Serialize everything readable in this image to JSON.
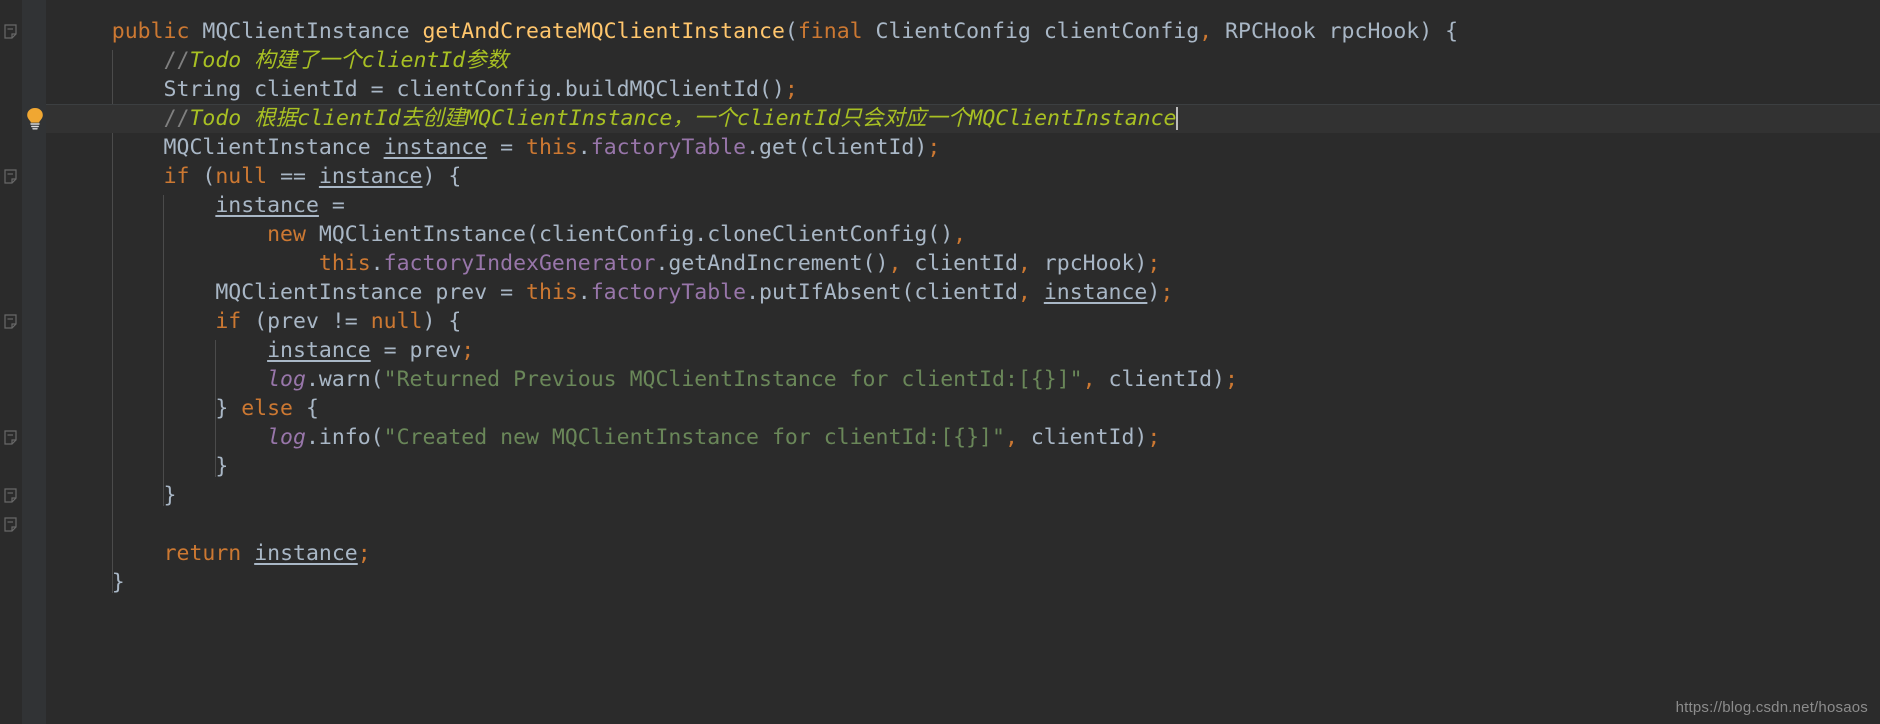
{
  "editor": {
    "theme_name": "darcula",
    "background": "#2b2b2b",
    "gutter_background": "#313335",
    "caret_line_background": "#323232",
    "default_text_color": "#a9b7c6"
  },
  "gutter": {
    "bulb_icon": "lightbulb-intention-icon",
    "bulb_color": "#f0a732",
    "fold_icon": "code-fold-region-icon",
    "fold_rows": [
      1,
      6,
      11,
      15,
      17,
      18,
      22
    ]
  },
  "code": {
    "lines": [
      {
        "n": 1,
        "fold": true,
        "tokens": [
          {
            "t": "    ",
            "c": "plain"
          },
          {
            "t": "public",
            "c": "kw"
          },
          {
            "t": " ",
            "c": "plain"
          },
          {
            "t": "MQClientInstance",
            "c": "cls"
          },
          {
            "t": " ",
            "c": "plain"
          },
          {
            "t": "getAndCreateMQClientInstance",
            "c": "mdecl"
          },
          {
            "t": "(",
            "c": "plain"
          },
          {
            "t": "final",
            "c": "kw"
          },
          {
            "t": " ",
            "c": "plain"
          },
          {
            "t": "ClientConfig clientConfig",
            "c": "plain"
          },
          {
            "t": ",",
            "c": "semi"
          },
          {
            "t": " RPCHook rpcHook) {",
            "c": "plain"
          }
        ]
      },
      {
        "n": 2,
        "tokens": [
          {
            "t": "        ",
            "c": "plain"
          },
          {
            "t": "//",
            "c": "cmt"
          },
          {
            "t": "Todo 构建了一个clientId参数",
            "c": "todo"
          }
        ]
      },
      {
        "n": 3,
        "tokens": [
          {
            "t": "        String clientId = clientConfig.buildMQClientId()",
            "c": "plain"
          },
          {
            "t": ";",
            "c": "semi"
          }
        ]
      },
      {
        "n": 4,
        "caret_line": true,
        "bulb": true,
        "tokens": [
          {
            "t": "        ",
            "c": "plain"
          },
          {
            "t": "//",
            "c": "cmt"
          },
          {
            "t": "Todo 根据clientId去创建MQClientInstance，一个clientId只会对应一个MQClientInstance",
            "c": "todo"
          },
          {
            "t": "",
            "c": "caret"
          }
        ]
      },
      {
        "n": 5,
        "tokens": [
          {
            "t": "        MQClientInstance ",
            "c": "plain"
          },
          {
            "t": "instance",
            "c": "local"
          },
          {
            "t": " = ",
            "c": "plain"
          },
          {
            "t": "this",
            "c": "kw"
          },
          {
            "t": ".",
            "c": "plain"
          },
          {
            "t": "factoryTable",
            "c": "field"
          },
          {
            "t": ".get(clientId)",
            "c": "plain"
          },
          {
            "t": ";",
            "c": "semi"
          }
        ]
      },
      {
        "n": 6,
        "fold": true,
        "tokens": [
          {
            "t": "        ",
            "c": "plain"
          },
          {
            "t": "if",
            "c": "kw"
          },
          {
            "t": " (",
            "c": "plain"
          },
          {
            "t": "null",
            "c": "kw"
          },
          {
            "t": " == ",
            "c": "plain"
          },
          {
            "t": "instance",
            "c": "local"
          },
          {
            "t": ") {",
            "c": "plain"
          }
        ]
      },
      {
        "n": 7,
        "tokens": [
          {
            "t": "            ",
            "c": "plain"
          },
          {
            "t": "instance",
            "c": "local"
          },
          {
            "t": " =",
            "c": "plain"
          }
        ]
      },
      {
        "n": 8,
        "tokens": [
          {
            "t": "                ",
            "c": "plain"
          },
          {
            "t": "new",
            "c": "kw"
          },
          {
            "t": " MQClientInstance(clientConfig.cloneClientConfig()",
            "c": "plain"
          },
          {
            "t": ",",
            "c": "semi"
          }
        ]
      },
      {
        "n": 9,
        "tokens": [
          {
            "t": "                    ",
            "c": "plain"
          },
          {
            "t": "this",
            "c": "kw"
          },
          {
            "t": ".",
            "c": "plain"
          },
          {
            "t": "factoryIndexGenerator",
            "c": "field"
          },
          {
            "t": ".getAndIncrement()",
            "c": "plain"
          },
          {
            "t": ",",
            "c": "semi"
          },
          {
            "t": " clientId",
            "c": "plain"
          },
          {
            "t": ",",
            "c": "semi"
          },
          {
            "t": " rpcHook)",
            "c": "plain"
          },
          {
            "t": ";",
            "c": "semi"
          }
        ]
      },
      {
        "n": 10,
        "tokens": [
          {
            "t": "            MQClientInstance prev = ",
            "c": "plain"
          },
          {
            "t": "this",
            "c": "kw"
          },
          {
            "t": ".",
            "c": "plain"
          },
          {
            "t": "factoryTable",
            "c": "field"
          },
          {
            "t": ".putIfAbsent(clientId",
            "c": "plain"
          },
          {
            "t": ",",
            "c": "semi"
          },
          {
            "t": " ",
            "c": "plain"
          },
          {
            "t": "instance",
            "c": "local"
          },
          {
            "t": ")",
            "c": "plain"
          },
          {
            "t": ";",
            "c": "semi"
          }
        ]
      },
      {
        "n": 11,
        "fold": true,
        "tokens": [
          {
            "t": "            ",
            "c": "plain"
          },
          {
            "t": "if",
            "c": "kw"
          },
          {
            "t": " (prev != ",
            "c": "plain"
          },
          {
            "t": "null",
            "c": "kw"
          },
          {
            "t": ") {",
            "c": "plain"
          }
        ]
      },
      {
        "n": 12,
        "tokens": [
          {
            "t": "                ",
            "c": "plain"
          },
          {
            "t": "instance",
            "c": "local"
          },
          {
            "t": " = prev",
            "c": "plain"
          },
          {
            "t": ";",
            "c": "semi"
          }
        ]
      },
      {
        "n": 13,
        "tokens": [
          {
            "t": "                ",
            "c": "plain"
          },
          {
            "t": "log",
            "c": "logv"
          },
          {
            "t": ".warn(",
            "c": "plain"
          },
          {
            "t": "\"Returned Previous MQClientInstance for clientId:[{}]\"",
            "c": "str"
          },
          {
            "t": ",",
            "c": "semi"
          },
          {
            "t": " clientId)",
            "c": "plain"
          },
          {
            "t": ";",
            "c": "semi"
          }
        ]
      },
      {
        "n": 14,
        "tokens": [
          {
            "t": "            } ",
            "c": "plain"
          },
          {
            "t": "else",
            "c": "kw"
          },
          {
            "t": " {",
            "c": "plain"
          }
        ]
      },
      {
        "n": 15,
        "fold": true,
        "tokens": [
          {
            "t": "                ",
            "c": "plain"
          },
          {
            "t": "log",
            "c": "logv"
          },
          {
            "t": ".info(",
            "c": "plain"
          },
          {
            "t": "\"Created new MQClientInstance for clientId:[{}]\"",
            "c": "str"
          },
          {
            "t": ",",
            "c": "semi"
          },
          {
            "t": " clientId)",
            "c": "plain"
          },
          {
            "t": ";",
            "c": "semi"
          }
        ]
      },
      {
        "n": 16,
        "tokens": [
          {
            "t": "            }",
            "c": "plain"
          }
        ]
      },
      {
        "n": 17,
        "fold": true,
        "tokens": [
          {
            "t": "        }",
            "c": "plain"
          }
        ]
      },
      {
        "n": 18,
        "fold": true,
        "tokens": [
          {
            "t": "",
            "c": "plain"
          }
        ]
      },
      {
        "n": 19,
        "tokens": [
          {
            "t": "        ",
            "c": "plain"
          },
          {
            "t": "return",
            "c": "kw"
          },
          {
            "t": " ",
            "c": "plain"
          },
          {
            "t": "instance",
            "c": "local"
          },
          {
            "t": ";",
            "c": "semi"
          }
        ]
      },
      {
        "n": 20,
        "tokens": [
          {
            "t": "    }",
            "c": "plain"
          }
        ]
      }
    ]
  },
  "watermark": {
    "text": "https://blog.csdn.net/hosaos"
  }
}
